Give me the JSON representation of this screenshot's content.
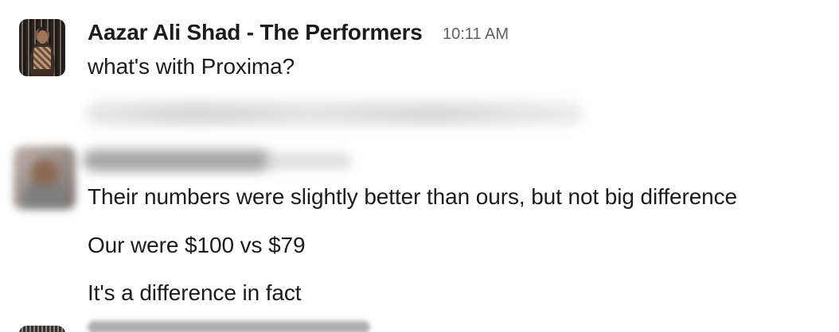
{
  "messages": {
    "first": {
      "sender": "Aazar Ali Shad - The Performers",
      "time": "10:11 AM",
      "text": "what's with Proxima?",
      "avatar": "profile-photo"
    },
    "second": {
      "avatar": "blurred-profile-photo",
      "lines": [
        "Their numbers were slightly better than ours, but not big difference",
        "Our were $100 vs $79",
        "It's a difference in fact"
      ]
    }
  }
}
